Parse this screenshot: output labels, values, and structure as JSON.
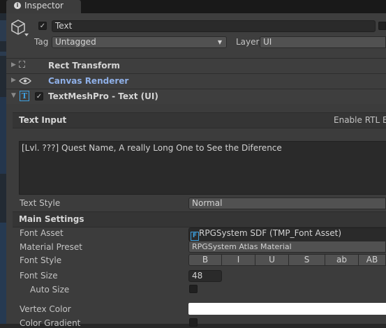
{
  "window": {
    "tab_label": "Inspector",
    "tab_icon": "info-icon"
  },
  "object": {
    "name": "Text",
    "active": true,
    "tag_label": "Tag",
    "tag_value": "Untagged",
    "layer_label": "Layer",
    "layer_value": "UI"
  },
  "components": [
    {
      "name": "Rect Transform",
      "icon": "rect-transform-icon"
    },
    {
      "name": "Canvas Renderer",
      "icon": "eye-icon"
    },
    {
      "name": "TextMeshPro - Text (UI)",
      "icon": "textmeshpro-icon",
      "enabled": true
    }
  ],
  "text_input": {
    "section_label": "Text Input",
    "rtl_label": "Enable RTL E",
    "value": "[Lvl. ???] Quest Name, A really Long One to See the Diference",
    "text_style_label": "Text Style",
    "text_style_value": "Normal"
  },
  "main_settings": {
    "section_label": "Main Settings",
    "font_asset_label": "Font Asset",
    "font_asset_value": "RPGSystem SDF (TMP_Font Asset)",
    "material_preset_label": "Material Preset",
    "material_preset_value": "RPGSystem Atlas Material",
    "font_style_label": "Font Style",
    "font_style_buttons": [
      "B",
      "I",
      "U",
      "S",
      "ab",
      "AB"
    ],
    "font_size_label": "Font Size",
    "font_size_value": "48",
    "auto_size_label": "Auto Size",
    "vertex_color_label": "Vertex Color",
    "vertex_color_value": "#ffffff",
    "color_gradient_label": "Color Gradient"
  }
}
